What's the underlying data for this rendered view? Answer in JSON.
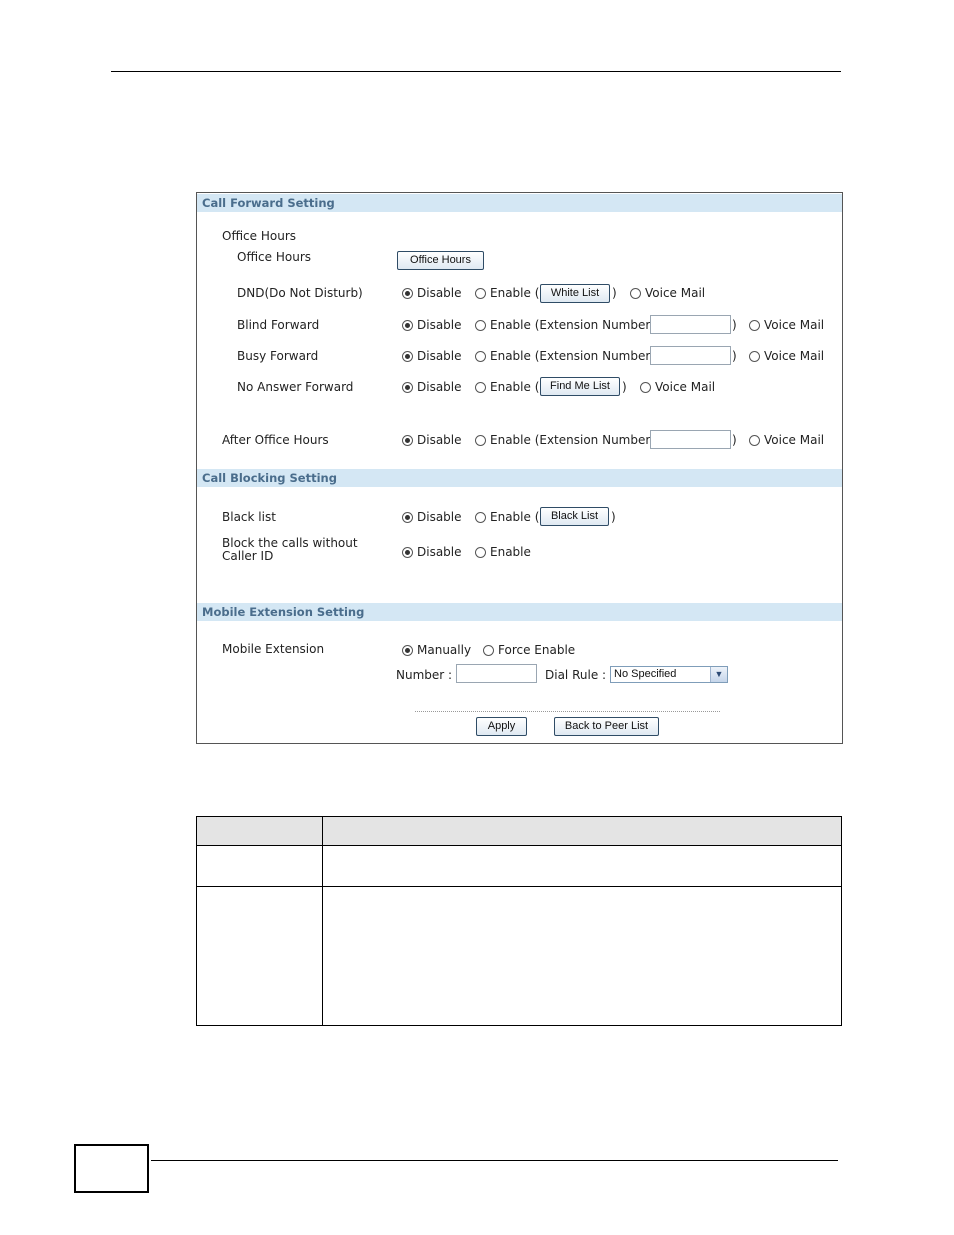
{
  "sections": {
    "call_forward": "Call Forward Setting",
    "call_blocking": "Call Blocking Setting",
    "mobile_extension": "Mobile Extension Setting"
  },
  "labels": {
    "office_hours_group": "Office Hours",
    "office_hours": "Office Hours",
    "dnd": "DND(Do Not Disturb)",
    "blind_forward": "Blind Forward",
    "busy_forward": "Busy Forward",
    "no_answer_forward": "No Answer Forward",
    "after_office_hours": "After Office Hours",
    "black_list": "Black list",
    "block_no_caller_id": "Block the calls without Caller ID",
    "mobile_extension": "Mobile Extension",
    "number": "Number :",
    "dial_rule": "Dial Rule :"
  },
  "options": {
    "disable": "Disable",
    "enable": "Enable",
    "enable_paren": "Enable (",
    "enable_ext": "Enable (Extension Number:",
    "voice_mail": "Voice Mail",
    "manually": "Manually",
    "force_enable": "Force Enable",
    "close_paren": ")"
  },
  "buttons": {
    "office_hours": "Office Hours",
    "white_list": "White List",
    "find_me_list": "Find Me List",
    "black_list": "Black List",
    "apply": "Apply",
    "back_to_peer_list": "Back to Peer List"
  },
  "dial_rule": {
    "selected": "No Specified"
  },
  "selected": {
    "dnd": "Disable",
    "blind_forward": "Disable",
    "busy_forward": "Disable",
    "no_answer_forward": "Disable",
    "after_office_hours": "Disable",
    "black_list": "Disable",
    "block_no_caller_id": "Disable",
    "mobile_extension": "Manually"
  },
  "colors": {
    "section_header_bg": "#d4e7f4",
    "section_header_text": "#4a6d8c",
    "table_header_bg": "#e4e4e4"
  }
}
